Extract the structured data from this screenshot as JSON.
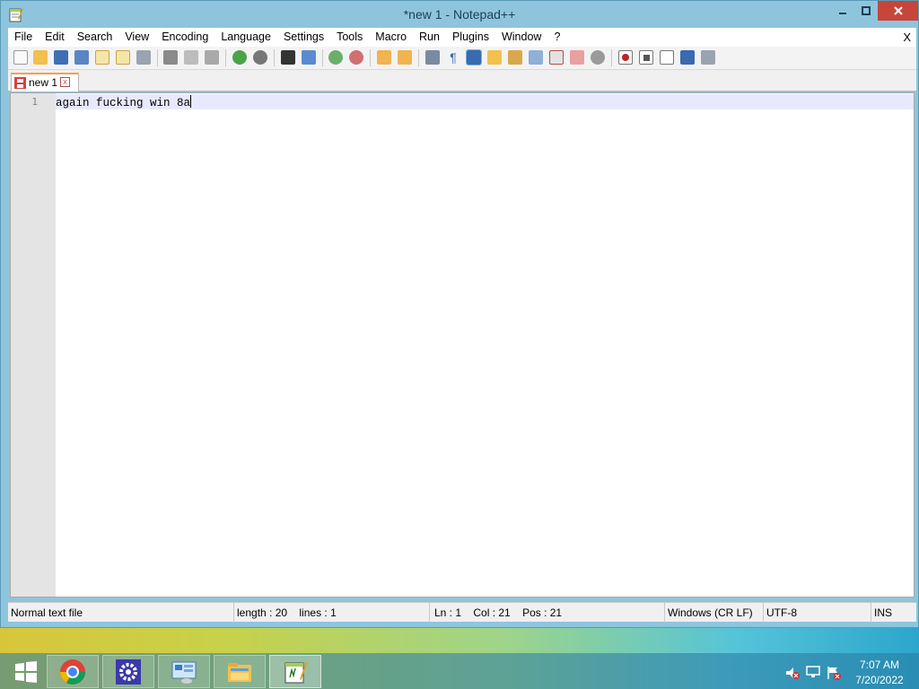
{
  "window": {
    "title": "*new 1 - Notepad++",
    "controls": {
      "minimize": "−",
      "maximize": "▢",
      "close": "✕"
    }
  },
  "menu": {
    "items": [
      "File",
      "Edit",
      "Search",
      "View",
      "Encoding",
      "Language",
      "Settings",
      "Tools",
      "Macro",
      "Run",
      "Plugins",
      "Window",
      "?"
    ],
    "close_label": "X"
  },
  "toolbar": {
    "icons": [
      "new-file-icon",
      "open-file-icon",
      "save-icon",
      "save-all-icon",
      "close-icon",
      "close-all-icon",
      "print-icon",
      "cut-icon",
      "copy-icon",
      "paste-icon",
      "undo-icon",
      "redo-icon",
      "find-icon",
      "replace-icon",
      "zoom-in-icon",
      "zoom-out-icon",
      "sync-vertical-icon",
      "sync-horizontal-icon",
      "word-wrap-icon",
      "show-all-chars-icon",
      "indent-guide-icon",
      "udl-icon",
      "doc-map-icon",
      "doc-list-icon",
      "function-list-icon",
      "folder-workspace-icon",
      "monitor-icon",
      "record-macro-icon",
      "stop-macro-icon",
      "play-macro-icon",
      "run-macro-multiple-icon",
      "save-macro-icon"
    ]
  },
  "tabs": [
    {
      "label": "new 1",
      "icon": "unsaved-file-icon",
      "close": "x"
    }
  ],
  "editor": {
    "line_numbers": [
      "1"
    ],
    "lines": [
      "again fucking win 8a"
    ]
  },
  "status": {
    "file_type": "Normal text file",
    "length": "length : 20",
    "lines": "lines : 1",
    "ln": "Ln : 1",
    "col": "Col : 21",
    "pos": "Pos : 21",
    "eol": "Windows (CR LF)",
    "encoding": "UTF-8",
    "mode": "INS"
  },
  "taskbar": {
    "apps": [
      "windows-start-icon",
      "chrome-icon",
      "settings-icon",
      "control-panel-icon",
      "file-explorer-icon",
      "notepadpp-icon"
    ],
    "clock": {
      "time": "7:07 AM",
      "date": "7/20/2022"
    }
  }
}
